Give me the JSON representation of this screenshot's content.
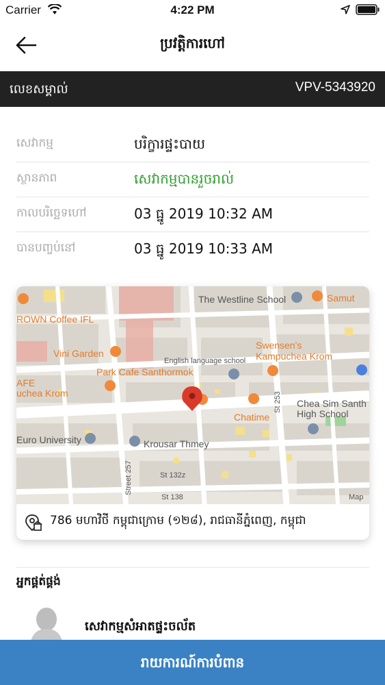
{
  "status_bar": {
    "carrier": "Carrier",
    "time": "4:22 PM"
  },
  "nav": {
    "title": "ប្រវត្តិការហៅ"
  },
  "id_bar": {
    "label": "លេខសម្គាល់",
    "value": "VPV-5343920"
  },
  "details": [
    {
      "label": "សេវាកម្ម",
      "value": "បរិក្ខារផ្ទះបាយ"
    },
    {
      "label": "ស្ថានភាព",
      "value": "សេវាកម្មបានរួចរាល់"
    },
    {
      "label": "កាលបរិច្ឆេទហៅ",
      "value": "03 ធ្នូ 2019 10:32 AM"
    },
    {
      "label": "បានបញ្ចប់នៅ",
      "value": "03 ធ្នូ 2019 10:33 AM"
    }
  ],
  "status_color": "#2e9d2e",
  "map": {
    "labels": [
      "The Westline School",
      "Samut",
      "ROWN Coffee IFL",
      "Vini Garden",
      "Swensen's",
      "Kampuchea Krom",
      "English language school",
      "Park Cafe Santhormok",
      "AFE",
      "uchea Krom",
      "Chea Sim Santh",
      "High School",
      "Chatime",
      "St 253",
      "Euro University",
      "Krousar Thmey",
      "Street 257",
      "St 132z",
      "St 138",
      "Map"
    ]
  },
  "address": "786 មហាវិថី កម្ពុជាក្រោម (១២៨), រាជធានីភ្នំពេញ, កម្ពុជា",
  "provider": {
    "heading": "អ្នកផ្គត់ផ្គង់",
    "name": "សេវាកម្មសំអាតផ្ទះចល័ត"
  },
  "cta": {
    "label": "រាយការណ៍ការបំពាន"
  },
  "accent": "#3a82c4"
}
